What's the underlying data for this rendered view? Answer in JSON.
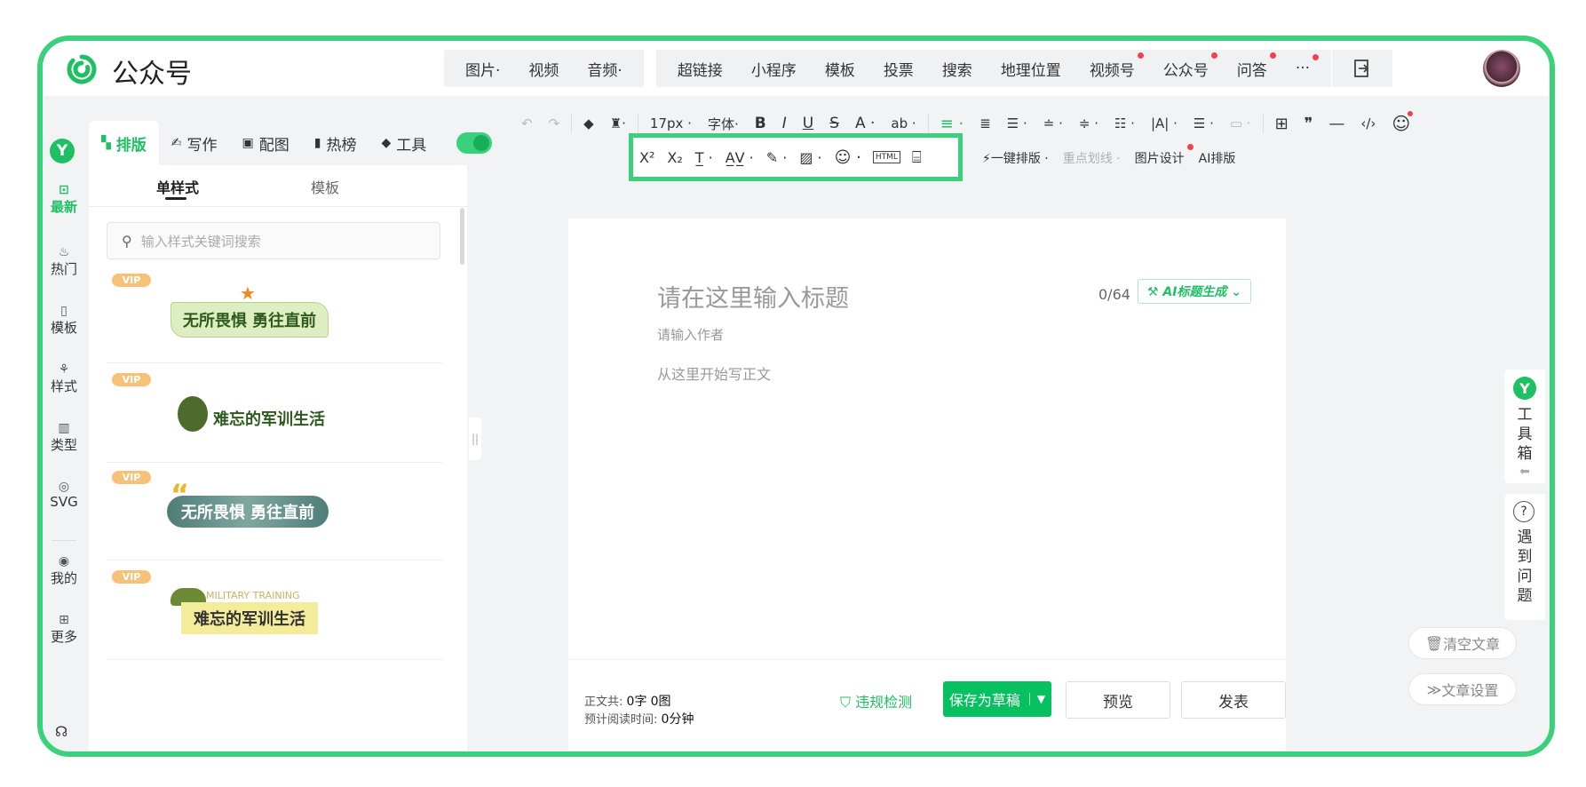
{
  "brand": {
    "name": "公众号",
    "accent": "#1fbf63",
    "frame": "#3ad17c"
  },
  "topmenu": {
    "media": [
      {
        "label": "图片·"
      },
      {
        "label": "视频"
      },
      {
        "label": "音频·"
      }
    ],
    "insert": [
      {
        "label": "超链接"
      },
      {
        "label": "小程序"
      },
      {
        "label": "模板"
      },
      {
        "label": "投票"
      },
      {
        "label": "搜索"
      },
      {
        "label": "地理位置"
      },
      {
        "label": "视频号",
        "dot": true
      },
      {
        "label": "公众号",
        "dot": true
      },
      {
        "label": "问答",
        "dot": true
      },
      {
        "label": "···",
        "dot": true
      }
    ]
  },
  "toolbar_row1": {
    "undo": "↶",
    "redo": "↷",
    "clear_format": "◆",
    "format_brush": "♜·",
    "font_size": "17px ·",
    "font_family": "字体·",
    "bold": "B",
    "italic": "I",
    "underline": "U",
    "strikethrough": "S",
    "font_color": "A ·",
    "bg_color": "ab ·",
    "align_left": "≡ ·",
    "align_center": "≣",
    "indent": "☰ ·",
    "line_height": "≐ ·",
    "para_spacing": "≑ ·",
    "list_indent": "☷ ·",
    "letter_spacing": "|A| ·",
    "list": "☰ ·",
    "border": "▭ ·",
    "table": "⊞",
    "quote": "❞",
    "divider": "—",
    "code": "‹/›",
    "emoji": "☺"
  },
  "toolbar_row2_highlight": {
    "superscript": "X²",
    "subscript": "X₂",
    "justify": "T̲ ·",
    "kerning": "A̲V̲ ·",
    "magic": "✎ ·",
    "image_tool": "▨ ·",
    "emoji": "☺ ·",
    "html": "HTML",
    "toolbox": "⌸"
  },
  "toolbar_row2_right": {
    "one_click": "⚡一键排版 ·",
    "highlight_line": "重点划线 ·",
    "image_design": "图片设计",
    "ai_layout": "AI排版"
  },
  "tabs": [
    {
      "label": "排版",
      "icon": "▚"
    },
    {
      "label": "写作",
      "icon": "✍"
    },
    {
      "label": "配图",
      "icon": "▣"
    },
    {
      "label": "热榜",
      "icon": "▮"
    },
    {
      "label": "工具",
      "icon": "◆"
    }
  ],
  "panel": {
    "tab_single": "单样式",
    "tab_template": "模板",
    "search_placeholder": "输入样式关键词搜索",
    "vip": "VIP",
    "cards": [
      {
        "text": "无所畏惧 勇往直前"
      },
      {
        "text": "难忘的军训生活"
      },
      {
        "text": "无所畏惧 勇往直前"
      },
      {
        "text": "难忘的军训生活",
        "sub": "MILITARY TRAINING"
      }
    ]
  },
  "leftnav": [
    {
      "label": "最新",
      "icon": "⊡"
    },
    {
      "label": "热门",
      "icon": "♨"
    },
    {
      "label": "模板",
      "icon": "▯"
    },
    {
      "label": "样式",
      "icon": "⚘"
    },
    {
      "label": "类型",
      "icon": "▥"
    },
    {
      "label": "SVG",
      "icon": "◎"
    },
    {
      "label": "我的",
      "icon": "◉"
    },
    {
      "label": "更多",
      "icon": "⊞"
    }
  ],
  "editor": {
    "title_placeholder": "请在这里输入标题",
    "title_count": "0/64",
    "ai_title": "⚒ AI标题生成 ⌄",
    "author_placeholder": "请输入作者",
    "body_placeholder": "从这里开始写正文"
  },
  "footer": {
    "stat_label1": "正文共:",
    "words": "0字",
    "images": "0图",
    "stat_label2": "预计阅读时间:",
    "minutes": "0分钟",
    "check": "违规检测",
    "save": "保存为草稿",
    "preview": "预览",
    "publish": "发表"
  },
  "side": {
    "toolbox": [
      "工",
      "具",
      "箱"
    ],
    "help": [
      "遇",
      "到",
      "问",
      "题"
    ],
    "clear": "清空文章",
    "settings": "文章设置"
  }
}
